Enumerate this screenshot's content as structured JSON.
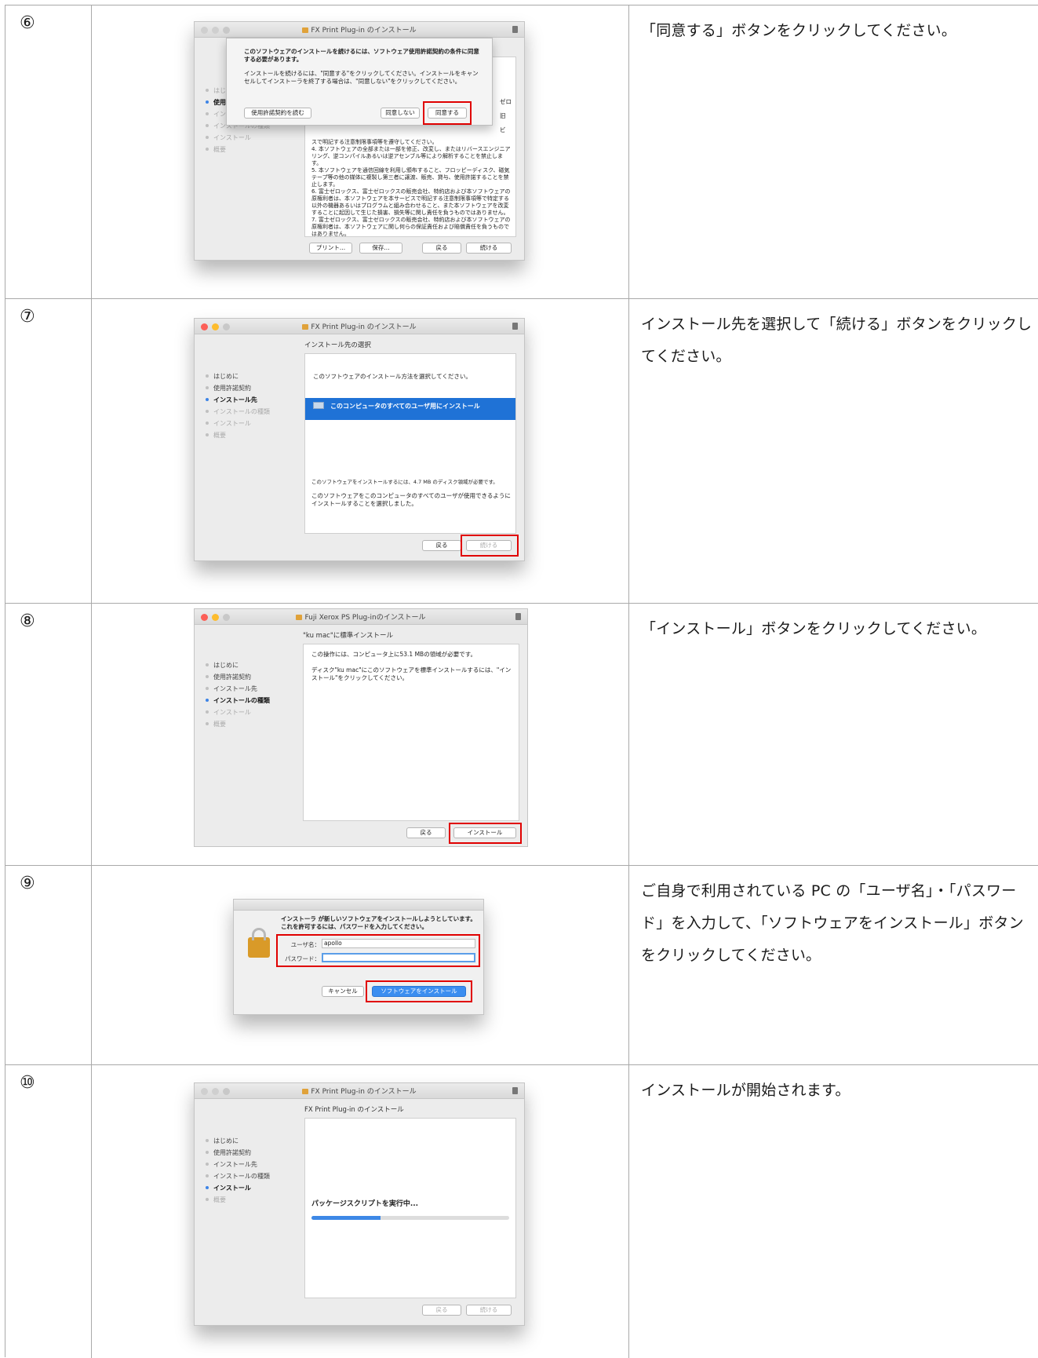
{
  "rows": [
    {
      "num": "⑥",
      "instruction": "「同意する」ボタンをクリックしてください。",
      "window": {
        "title": "FX Print Plug-in のインストール",
        "sidebar": [
          "はじめに",
          "使用許諾契約",
          "インストール先",
          "インストールの種類",
          "インストール",
          "概要"
        ],
        "sheet": {
          "heading": "このソフトウェアのインストールを続けるには、ソフトウェア使用許諾契約の条件に同意する必要があります。",
          "body": "インストールを続けるには、\"同意する\"をクリックしてください。インストールをキャンセルしてインストーラを終了する場合は、\"同意しない\"をクリックしてください。",
          "read_button": "使用許諾契約を読む",
          "disagree_button": "同意しない",
          "agree_button": "同意する"
        },
        "license_text": [
          "スで明記する注意制限事項等を遵守してください。",
          "4. 本ソフトウェアの全部または一部を修正、改変し、またはリバースエンジニアリング、逆コンパイルあるいは逆アセンブル等により解析することを禁止します。",
          "5. 本ソフトウェアを通信回線を利用し頒布すること、フロッピーディスク、磁気テープ等の他の媒体に複製し第三者に譲渡、販売、貸与、使用許諾することを禁止します。",
          "6. 富士ゼロックス、富士ゼロックスの販売会社、特約店および本ソフトウェアの原権利者は、本ソフトウェアを本サービスで明記する注意制限事項等で特定する以外の機器あるいはプログラムと組み合わせること、また本ソフトウェアを改変することに起因して生じた損害、損失等に関し責任を負うものではありません。",
          "7. 富士ゼロックス、富士ゼロックスの販売会社、特約店および本ソフトウェアの原権利者は、本ソフトウェアに関し何らの保証責任および賠償責任を負うものではありません。"
        ],
        "side_fragments": [
          "ゼロ",
          "旧",
          "ビ"
        ],
        "buttons": {
          "print": "プリント...",
          "save": "保存...",
          "back": "戻る",
          "continue": "続ける"
        }
      }
    },
    {
      "num": "⑦",
      "instruction": "インストール先を選択して「続ける」ボタンをクリックしてください。",
      "window": {
        "title": "FX Print Plug-in のインストール",
        "pane_title": "インストール先の選択",
        "sidebar": [
          "はじめに",
          "使用許諾契約",
          "インストール先",
          "インストールの種類",
          "インストール",
          "概要"
        ],
        "prompt": "このソフトウェアのインストール方法を選択してください。",
        "option": "このコンピュータのすべてのユーザ用にインストール",
        "disk_note": "このソフトウェアをインストールするには、4.7 MB のディスク領域が必要です。",
        "selected_note": "このソフトウェアをこのコンピュータのすべてのユーザが使用できるようにインストールすることを選択しました。",
        "buttons": {
          "back": "戻る",
          "continue": "続ける"
        }
      }
    },
    {
      "num": "⑧",
      "instruction": "「インストール」ボタンをクリックしてください。",
      "window": {
        "title": "Fuji Xerox PS Plug-inのインストール",
        "pane_title": "\"ku mac\"に標準インストール",
        "sidebar": [
          "はじめに",
          "使用許諾契約",
          "インストール先",
          "インストールの種類",
          "インストール",
          "概要"
        ],
        "line1": "この操作には、コンピュータ上に53.1 MBの領域が必要です。",
        "line2": "ディスク\"ku mac\"にこのソフトウェアを標準インストールするには、\"インストール\"をクリックしてください。",
        "buttons": {
          "back": "戻る",
          "install": "インストール"
        }
      }
    },
    {
      "num": "⑨",
      "instruction": "ご自身で利用されている PC の「ユーザ名」・「パスワード」を入力して、「ソフトウェアをインストール」ボタンをクリックしてください。",
      "dialog": {
        "message": "インストーラ が新しいソフトウェアをインストールしようとしています。これを許可するには、パスワードを入力してください。",
        "username_label": "ユーザ名：",
        "username_value": "apollo",
        "password_label": "パスワード：",
        "cancel_button": "キャンセル",
        "install_button": "ソフトウェアをインストール"
      }
    },
    {
      "num": "⑩",
      "instruction": "インストールが開始されます。",
      "window": {
        "title": "FX Print Plug-in のインストール",
        "pane_title": "FX Print Plug-in のインストール",
        "sidebar": [
          "はじめに",
          "使用許諾契約",
          "インストール先",
          "インストールの種類",
          "インストール",
          "概要"
        ],
        "status": "パッケージスクリプトを実行中...",
        "progress": 0.35,
        "buttons": {
          "back": "戻る",
          "continue": "続ける"
        }
      }
    }
  ],
  "colors": {
    "highlight": "#e00000",
    "accent": "#3d84e6"
  }
}
